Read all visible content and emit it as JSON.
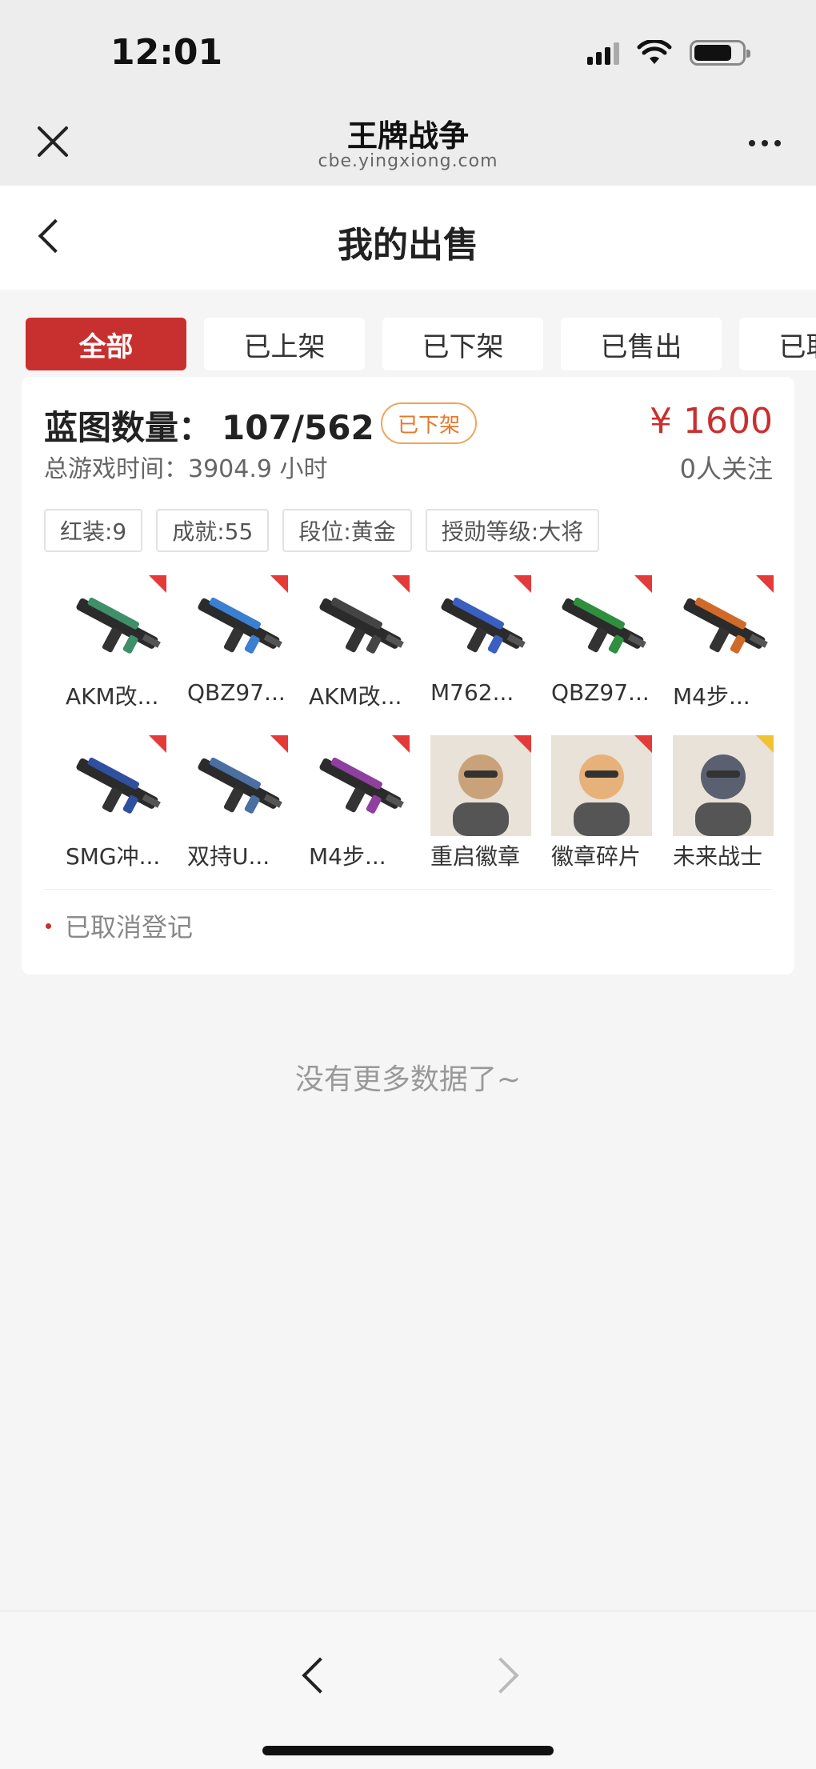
{
  "status_bar": {
    "time": "12:01"
  },
  "browser": {
    "title": "王牌战争",
    "url": "cbe.yingxiong.com"
  },
  "page": {
    "title": "我的出售"
  },
  "tabs": [
    {
      "label": "全部",
      "active": true
    },
    {
      "label": "已上架",
      "active": false
    },
    {
      "label": "已下架",
      "active": false
    },
    {
      "label": "已售出",
      "active": false
    },
    {
      "label": "已取消",
      "active": false
    }
  ],
  "listing": {
    "blueprint_label": "蓝图数量：",
    "blueprint_value": "107/562",
    "status_tag": "已下架",
    "price": "¥ 1600",
    "playtime": "总游戏时间：3904.9 小时",
    "followers": "0人关注",
    "chips": [
      "红装:9",
      "成就:55",
      "段位:黄金",
      "授勋等级:大将"
    ],
    "items": [
      {
        "name": "AKM改...",
        "kind": "gun",
        "color": "#3f8f6a"
      },
      {
        "name": "QBZ97...",
        "kind": "gun",
        "color": "#3a7fd0"
      },
      {
        "name": "AKM改...",
        "kind": "gun",
        "color": "#444444"
      },
      {
        "name": "M762...",
        "kind": "gun",
        "color": "#3a5fc0"
      },
      {
        "name": "QBZ97...",
        "kind": "gun",
        "color": "#2f8f3f"
      },
      {
        "name": "M4步...",
        "kind": "gun",
        "color": "#d06a2a"
      },
      {
        "name": "SMG冲...",
        "kind": "gun",
        "color": "#2f4f9f"
      },
      {
        "name": "双持U...",
        "kind": "gun",
        "color": "#4a6fa0"
      },
      {
        "name": "M4步...",
        "kind": "gun",
        "color": "#8f3f9f"
      },
      {
        "name": "重启徽章",
        "kind": "portrait",
        "color": "#caa27a"
      },
      {
        "name": "徽章碎片",
        "kind": "portrait",
        "color": "#e6b27a"
      },
      {
        "name": "未来战士",
        "kind": "portrait",
        "color": "#5a6070"
      }
    ],
    "cancel_note": "已取消登记"
  },
  "no_more": "没有更多数据了~",
  "colors": {
    "accent": "#c8302f",
    "tag_orange": "#e4792b",
    "background": "#f5f5f5"
  }
}
